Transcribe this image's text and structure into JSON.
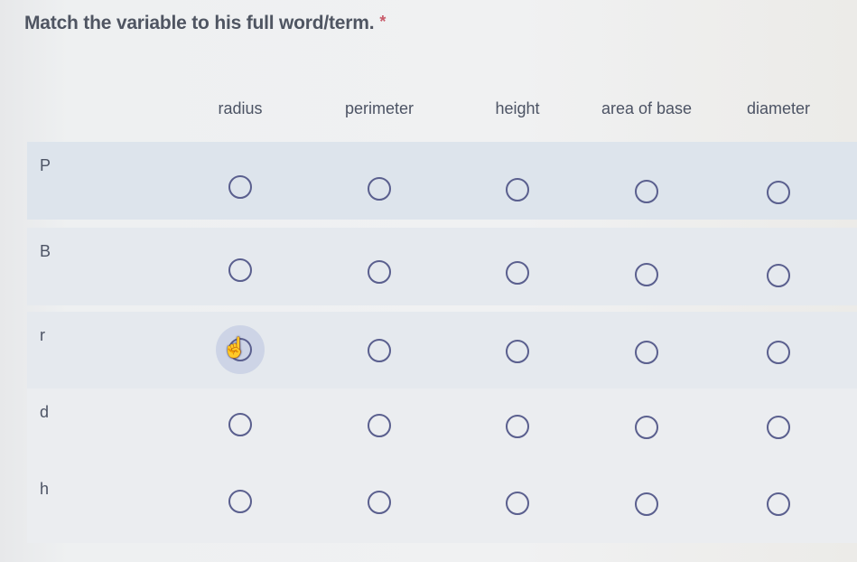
{
  "question": {
    "title": "Match the variable to his full word/term.",
    "required_marker": "*"
  },
  "columns": [
    "radius",
    "perimeter",
    "height",
    "area of base",
    "diameter"
  ],
  "rows": [
    {
      "label": "P",
      "selected": null
    },
    {
      "label": "B",
      "selected": null
    },
    {
      "label": "r",
      "selected": null
    },
    {
      "label": "d",
      "selected": null
    },
    {
      "label": "h",
      "selected": null
    }
  ],
  "hover": {
    "row": "r",
    "column": "radius",
    "cursor": "pointer-hand"
  },
  "colors": {
    "radio_border": "#5a5f8e",
    "required": "#c85a6a",
    "row_bg": "#dde4ec",
    "text": "#4c5364"
  }
}
